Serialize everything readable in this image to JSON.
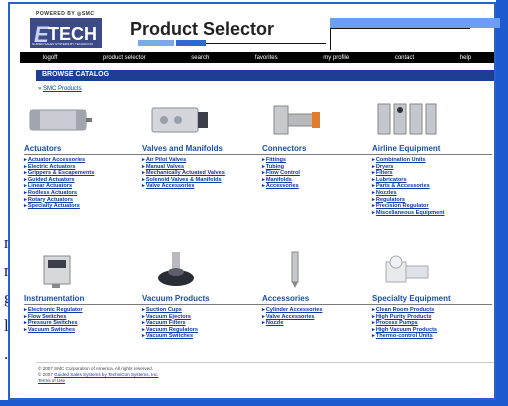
{
  "side_letters": [
    "n",
    "n",
    "g",
    "l",
    "."
  ],
  "header": {
    "powered_by": "POWERED BY ◎SMC",
    "logo_text": "TECH",
    "logo_tagline": "GUIDED SALES SYSTEMS BY TECHNICON",
    "title": "Product Selector"
  },
  "nav": [
    "logoff",
    "product selector",
    "search",
    "favorites",
    "my profile",
    "contact",
    "help"
  ],
  "browse_title": "BROWSE CATALOG",
  "breadcrumb": "SMC Products",
  "categories": [
    {
      "title": "Actuators",
      "icon": "actuator-icon",
      "items": [
        "Actuator Accessories",
        "Electric Actuators",
        "Grippers & Escapements",
        "Guided Actuators",
        "Linear Actuators",
        "Rodless Actuators",
        "Rotary Actuators",
        "Specialty Actuators"
      ]
    },
    {
      "title": "Valves and Manifolds",
      "icon": "valve-icon",
      "items": [
        "Air Pilot Valves",
        "Manual Valves",
        "Mechanically Actuated Valves",
        "Solenoid Valves & Manifolds",
        "Valve Accessories"
      ]
    },
    {
      "title": "Connectors",
      "icon": "fitting-icon",
      "items": [
        "Fittings",
        "Tubing",
        "Flow Control",
        "Manifolds",
        "Accessories"
      ]
    },
    {
      "title": "Airline Equipment",
      "icon": "frl-icon",
      "items": [
        "Combination Units",
        "Dryers",
        "Filters",
        "Lubricators",
        "Parts & Accessories",
        "Nozzles",
        "Regulators",
        "Precision Regulator",
        "Miscellaneous Equipment"
      ]
    },
    {
      "title": "Instrumentation",
      "icon": "gauge-icon",
      "items": [
        "Electronic Regulator",
        "Flow Switches",
        "Pressure Switches",
        "Vacuum Switches"
      ]
    },
    {
      "title": "Vacuum Products",
      "icon": "suction-cup-icon",
      "items": [
        "Suction Cups",
        "Vacuum Ejectors",
        "Vacuum Filters",
        "Vacuum Regulators",
        "Vacuum Switches"
      ]
    },
    {
      "title": "Accessories",
      "icon": "nozzle-icon",
      "items": [
        "Cylinder Accessories",
        "Valve Accessories",
        "Nozzle"
      ]
    },
    {
      "title": "Specialty Equipment",
      "icon": "specialty-icon",
      "items": [
        "Clean Room Products",
        "High Purity Products",
        "Process Pumps",
        "High Vacuum Products",
        "Thermo-control Units"
      ]
    }
  ],
  "footer": {
    "line1": "© 2007 SMC Corporation of America. All rights reserved.",
    "line2_prefix": "© 2007 ",
    "line2_link": "Guided Sales Systems by TechniCon Systems, Inc.",
    "terms": "Terms of Use"
  },
  "colors": {
    "brand_blue": "#1c3f94",
    "link": "#0b3aa8",
    "frame": "#2b62c4"
  }
}
